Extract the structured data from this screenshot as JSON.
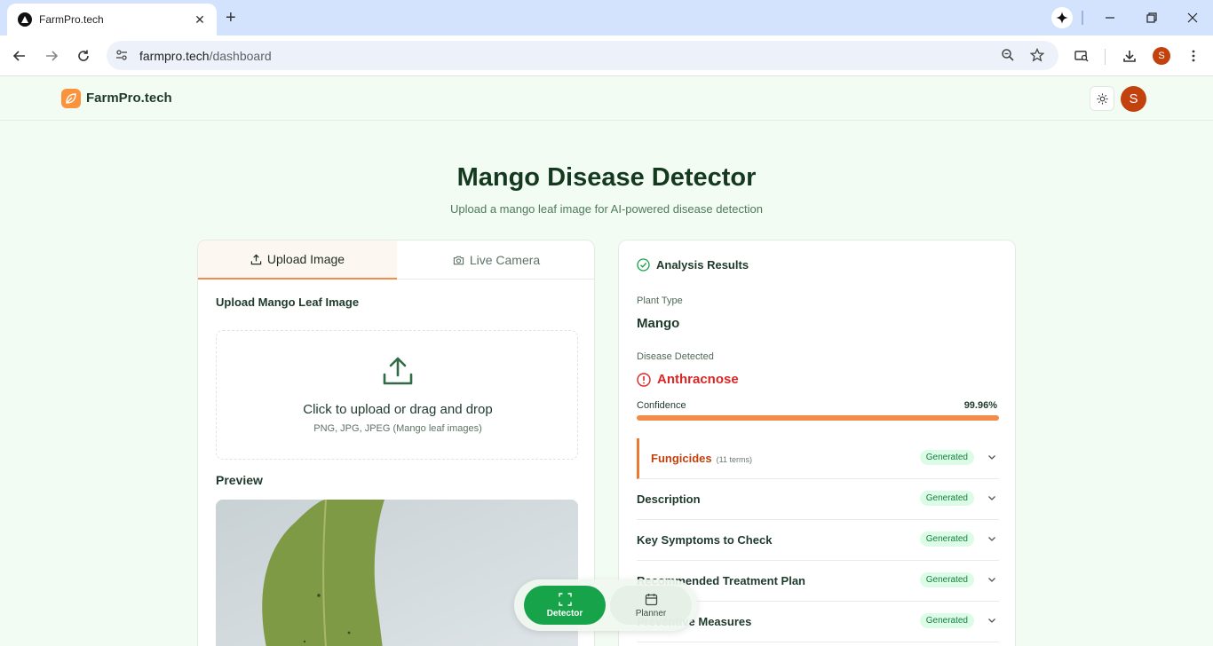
{
  "browser": {
    "tab_title": "FarmPro.tech",
    "url_host": "farmpro.tech",
    "url_path": "/dashboard",
    "profile_initial": "S"
  },
  "app": {
    "logo_text": "FarmPro.tech",
    "avatar_initial": "S"
  },
  "hero": {
    "title": "Mango Disease Detector",
    "subtitle": "Upload a mango leaf image for AI-powered disease detection"
  },
  "upload_card": {
    "tabs": [
      {
        "label": "Upload Image",
        "active": true
      },
      {
        "label": "Live Camera",
        "active": false
      }
    ],
    "section_label": "Upload Mango Leaf Image",
    "dropzone_main": "Click to upload or drag and drop",
    "dropzone_sub": "PNG, JPG, JPEG (Mango leaf images)",
    "preview_label": "Preview"
  },
  "results": {
    "heading": "Analysis Results",
    "plant_type_label": "Plant Type",
    "plant_type": "Mango",
    "disease_label": "Disease Detected",
    "disease": "Anthracnose",
    "confidence_label": "Confidence",
    "confidence_text": "99.96%",
    "confidence_value": 99.96,
    "sections": [
      {
        "title": "Fungicides",
        "note": "(11 terms)",
        "badge": "Generated",
        "active": true
      },
      {
        "title": "Description",
        "badge": "Generated",
        "active": false
      },
      {
        "title": "Key Symptoms to Check",
        "badge": "Generated",
        "active": false
      },
      {
        "title": "Recommended Treatment Plan",
        "badge": "Generated",
        "active": false
      },
      {
        "title": "Preventive Measures",
        "badge": "Generated",
        "active": false
      }
    ]
  },
  "floating_nav": {
    "items": [
      {
        "label": "Detector",
        "icon": "scan-icon",
        "active": true
      },
      {
        "label": "Planner",
        "icon": "calendar-icon",
        "active": false
      }
    ]
  },
  "colors": {
    "accent_green": "#16a34a",
    "accent_orange": "#f28c4a",
    "danger": "#dc2626",
    "page_bg": "#f3fcf3"
  }
}
